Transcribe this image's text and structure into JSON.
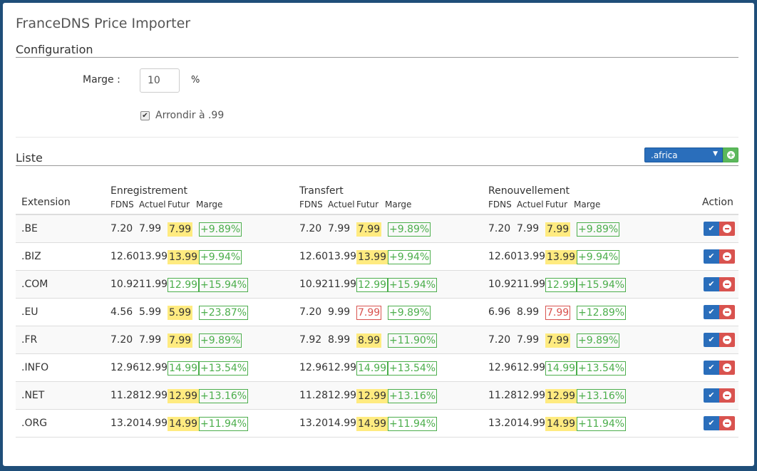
{
  "title": "FranceDNS Price Importer",
  "config": {
    "heading": "Configuration",
    "marge_label": "Marge :",
    "marge_value": "10",
    "percent": "%",
    "round_checked": true,
    "round_label": "Arrondir à .99"
  },
  "list": {
    "heading": "Liste",
    "select_value": ".africa",
    "add_icon": "plus-circle-icon"
  },
  "table": {
    "col_extension": "Extension",
    "col_action": "Action",
    "groups": [
      "Enregistrement",
      "Transfert",
      "Renouvellement"
    ],
    "sub": [
      "FDNS",
      "Actuel",
      "Futur",
      "Marge"
    ],
    "colors": {
      "yellow": "#ffeb80",
      "green": "#4cae4c",
      "red": "#d9534f"
    },
    "rows": [
      {
        "ext": ".BE",
        "reg": {
          "fdns": "7.20",
          "actuel": "7.99",
          "futur": "7.99",
          "futur_style": "yellow",
          "marge": "+9.89%"
        },
        "tra": {
          "fdns": "7.20",
          "actuel": "7.99",
          "futur": "7.99",
          "futur_style": "yellow",
          "marge": "+9.89%"
        },
        "ren": {
          "fdns": "7.20",
          "actuel": "7.99",
          "futur": "7.99",
          "futur_style": "yellow",
          "marge": "+9.89%"
        }
      },
      {
        "ext": ".BIZ",
        "reg": {
          "fdns": "12.60",
          "actuel": "13.99",
          "futur": "13.99",
          "futur_style": "yellow",
          "marge": "+9.94%"
        },
        "tra": {
          "fdns": "12.60",
          "actuel": "13.99",
          "futur": "13.99",
          "futur_style": "yellow",
          "marge": "+9.94%"
        },
        "ren": {
          "fdns": "12.60",
          "actuel": "13.99",
          "futur": "13.99",
          "futur_style": "yellow",
          "marge": "+9.94%"
        }
      },
      {
        "ext": ".COM",
        "reg": {
          "fdns": "10.92",
          "actuel": "11.99",
          "futur": "12.99",
          "futur_style": "green",
          "marge": "+15.94%"
        },
        "tra": {
          "fdns": "10.92",
          "actuel": "11.99",
          "futur": "12.99",
          "futur_style": "green",
          "marge": "+15.94%"
        },
        "ren": {
          "fdns": "10.92",
          "actuel": "11.99",
          "futur": "12.99",
          "futur_style": "green",
          "marge": "+15.94%"
        }
      },
      {
        "ext": ".EU",
        "reg": {
          "fdns": "4.56",
          "actuel": "5.99",
          "futur": "5.99",
          "futur_style": "yellow",
          "marge": "+23.87%"
        },
        "tra": {
          "fdns": "7.20",
          "actuel": "9.99",
          "futur": "7.99",
          "futur_style": "red",
          "marge": "+9.89%"
        },
        "ren": {
          "fdns": "6.96",
          "actuel": "8.99",
          "futur": "7.99",
          "futur_style": "red",
          "marge": "+12.89%"
        }
      },
      {
        "ext": ".FR",
        "reg": {
          "fdns": "7.20",
          "actuel": "7.99",
          "futur": "7.99",
          "futur_style": "yellow",
          "marge": "+9.89%"
        },
        "tra": {
          "fdns": "7.92",
          "actuel": "8.99",
          "futur": "8.99",
          "futur_style": "yellow",
          "marge": "+11.90%"
        },
        "ren": {
          "fdns": "7.20",
          "actuel": "7.99",
          "futur": "7.99",
          "futur_style": "yellow",
          "marge": "+9.89%"
        }
      },
      {
        "ext": ".INFO",
        "reg": {
          "fdns": "12.96",
          "actuel": "12.99",
          "futur": "14.99",
          "futur_style": "green",
          "marge": "+13.54%"
        },
        "tra": {
          "fdns": "12.96",
          "actuel": "12.99",
          "futur": "14.99",
          "futur_style": "green",
          "marge": "+13.54%"
        },
        "ren": {
          "fdns": "12.96",
          "actuel": "12.99",
          "futur": "14.99",
          "futur_style": "green",
          "marge": "+13.54%"
        }
      },
      {
        "ext": ".NET",
        "reg": {
          "fdns": "11.28",
          "actuel": "12.99",
          "futur": "12.99",
          "futur_style": "yellow",
          "marge": "+13.16%"
        },
        "tra": {
          "fdns": "11.28",
          "actuel": "12.99",
          "futur": "12.99",
          "futur_style": "yellow",
          "marge": "+13.16%"
        },
        "ren": {
          "fdns": "11.28",
          "actuel": "12.99",
          "futur": "12.99",
          "futur_style": "yellow",
          "marge": "+13.16%"
        }
      },
      {
        "ext": ".ORG",
        "reg": {
          "fdns": "13.20",
          "actuel": "14.99",
          "futur": "14.99",
          "futur_style": "yellow",
          "marge": "+11.94%"
        },
        "tra": {
          "fdns": "13.20",
          "actuel": "14.99",
          "futur": "14.99",
          "futur_style": "yellow",
          "marge": "+11.94%"
        },
        "ren": {
          "fdns": "13.20",
          "actuel": "14.99",
          "futur": "14.99",
          "futur_style": "yellow",
          "marge": "+11.94%"
        }
      }
    ],
    "action_icons": [
      "check-icon",
      "minus-circle-icon"
    ]
  }
}
